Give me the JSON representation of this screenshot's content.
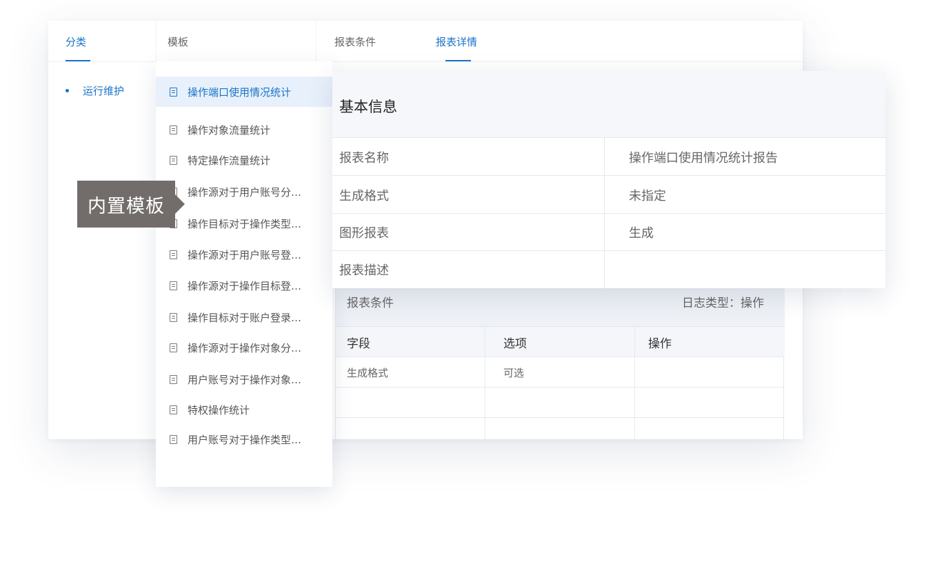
{
  "header": {
    "tab_category": "分类",
    "tab_template": "模板",
    "tab_conditions": "报表条件",
    "tab_details": "报表详情"
  },
  "category": {
    "items": [
      {
        "label": "运行维护"
      }
    ]
  },
  "templates": {
    "items": [
      {
        "label": "操作端口使用情况统计",
        "active": true
      },
      {
        "label": "操作对象流量统计"
      },
      {
        "label": "特定操作流量统计"
      },
      {
        "label": "操作源对于用户账号分…"
      },
      {
        "label": "操作目标对于操作类型…"
      },
      {
        "label": "操作源对于用户账号登…"
      },
      {
        "label": "操作源对于操作目标登…"
      },
      {
        "label": "操作目标对于账户登录…"
      },
      {
        "label": "操作源对于操作对象分…"
      },
      {
        "label": "用户账号对于操作对象…"
      },
      {
        "label": "特权操作统计"
      },
      {
        "label": "用户账号对于操作类型…"
      }
    ]
  },
  "tooltip": {
    "text": "内置模板"
  },
  "basic_info": {
    "title": "基本信息",
    "rows": [
      {
        "label": "报表名称",
        "value": "操作端口使用情况统计报告"
      },
      {
        "label": "生成格式",
        "value": "未指定"
      },
      {
        "label": "图形报表",
        "value": "生成"
      },
      {
        "label": "报表描述",
        "value": ""
      }
    ]
  },
  "conditions": {
    "title": "报表条件",
    "meta": "日志类型：操作",
    "columns": [
      "字段",
      "选项",
      "操作"
    ],
    "rows": [
      [
        "生成格式",
        "可选",
        ""
      ],
      [
        "",
        "",
        ""
      ],
      [
        "",
        "",
        ""
      ]
    ]
  },
  "colors": {
    "accent": "#1a73c8",
    "tooltip_bg": "#726d6b",
    "active_item_bg": "#e8f1fb"
  },
  "icons": {
    "template_item": "document-icon",
    "category_item": "bullet-icon"
  }
}
